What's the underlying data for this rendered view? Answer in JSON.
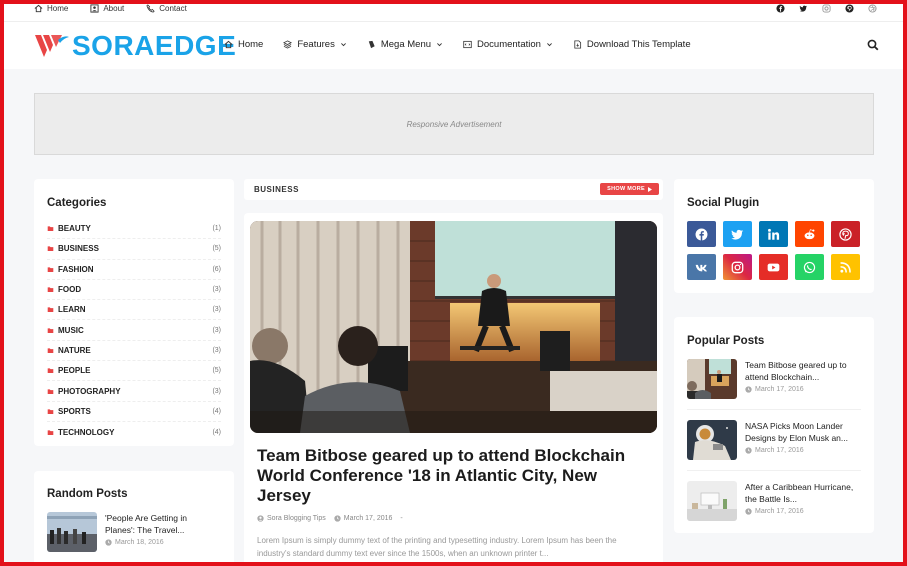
{
  "topbar": {
    "links": [
      {
        "label": "Home",
        "icon": "home-icon"
      },
      {
        "label": "About",
        "icon": "user-icon"
      },
      {
        "label": "Contact",
        "icon": "phone-icon"
      }
    ],
    "social_icons": [
      "facebook-icon",
      "twitter-icon",
      "instagram-icon",
      "pinterest-icon",
      "dribbble-icon"
    ]
  },
  "header": {
    "logo_text": "SORAEDGE",
    "nav": [
      {
        "label": "Home",
        "icon": "home-icon",
        "dropdown": false
      },
      {
        "label": "Features",
        "icon": "layers-icon",
        "dropdown": true
      },
      {
        "label": "Mega Menu",
        "icon": "bookmark-icon",
        "dropdown": true
      },
      {
        "label": "Documentation",
        "icon": "code-icon",
        "dropdown": true
      },
      {
        "label": "Download This Template",
        "icon": "file-icon",
        "dropdown": false
      }
    ]
  },
  "ad": {
    "label": "Responsive Advertisement"
  },
  "categories": {
    "title": "Categories",
    "items": [
      {
        "label": "BEAUTY",
        "count": "(1)"
      },
      {
        "label": "BUSINESS",
        "count": "(5)"
      },
      {
        "label": "FASHION",
        "count": "(6)"
      },
      {
        "label": "FOOD",
        "count": "(3)"
      },
      {
        "label": "LEARN",
        "count": "(3)"
      },
      {
        "label": "MUSIC",
        "count": "(3)"
      },
      {
        "label": "NATURE",
        "count": "(3)"
      },
      {
        "label": "PEOPLE",
        "count": "(5)"
      },
      {
        "label": "PHOTOGRAPHY",
        "count": "(3)"
      },
      {
        "label": "SPORTS",
        "count": "(4)"
      },
      {
        "label": "TECHNOLOGY",
        "count": "(4)"
      }
    ]
  },
  "random_posts": {
    "title": "Random Posts",
    "items": [
      {
        "title": "'People Are Getting in Planes': The Travel...",
        "date": "March 18, 2016"
      }
    ]
  },
  "main": {
    "section_label": "BUSINESS",
    "show_more": "SHOW MORE",
    "post": {
      "title": "Team Bitbose geared up to attend Blockchain World Conference '18 in Atlantic City, New Jersey",
      "author": "Sora Blogging Tips",
      "date": "March 17, 2016",
      "meta_sep": "-",
      "excerpt": "Lorem Ipsum is simply dummy text of the printing and typesetting industry. Lorem Ipsum has been the industry's standard dummy text ever since the 1500s, when an unknown printer t..."
    }
  },
  "social_plugin": {
    "title": "Social Plugin",
    "buttons": [
      {
        "icon": "facebook-icon",
        "color": "#3b5998"
      },
      {
        "icon": "twitter-icon",
        "color": "#1da1f2"
      },
      {
        "icon": "linkedin-icon",
        "color": "#0077b5"
      },
      {
        "icon": "reddit-icon",
        "color": "#ff4500"
      },
      {
        "icon": "pinterest-icon",
        "color": "#ca2127"
      },
      {
        "icon": "vk-icon",
        "color": "#4a76a8"
      },
      {
        "icon": "instagram-icon",
        "color": "#c13584"
      },
      {
        "icon": "youtube-icon",
        "color": "#e52d27"
      },
      {
        "icon": "whatsapp-icon",
        "color": "#25d366"
      },
      {
        "icon": "rss-icon",
        "color": "#ffc200"
      }
    ]
  },
  "popular_posts": {
    "title": "Popular Posts",
    "items": [
      {
        "title": "Team Bitbose geared up to attend Blockchain...",
        "date": "March 17, 2016"
      },
      {
        "title": "NASA Picks Moon Lander Designs by Elon Musk an...",
        "date": "March 17, 2016"
      },
      {
        "title": "After a Caribbean Hurricane, the Battle Is...",
        "date": "March 17, 2016"
      }
    ]
  },
  "colors": {
    "accent": "#e84545",
    "brand": "#1aa3e8",
    "frame": "#e3111a"
  }
}
